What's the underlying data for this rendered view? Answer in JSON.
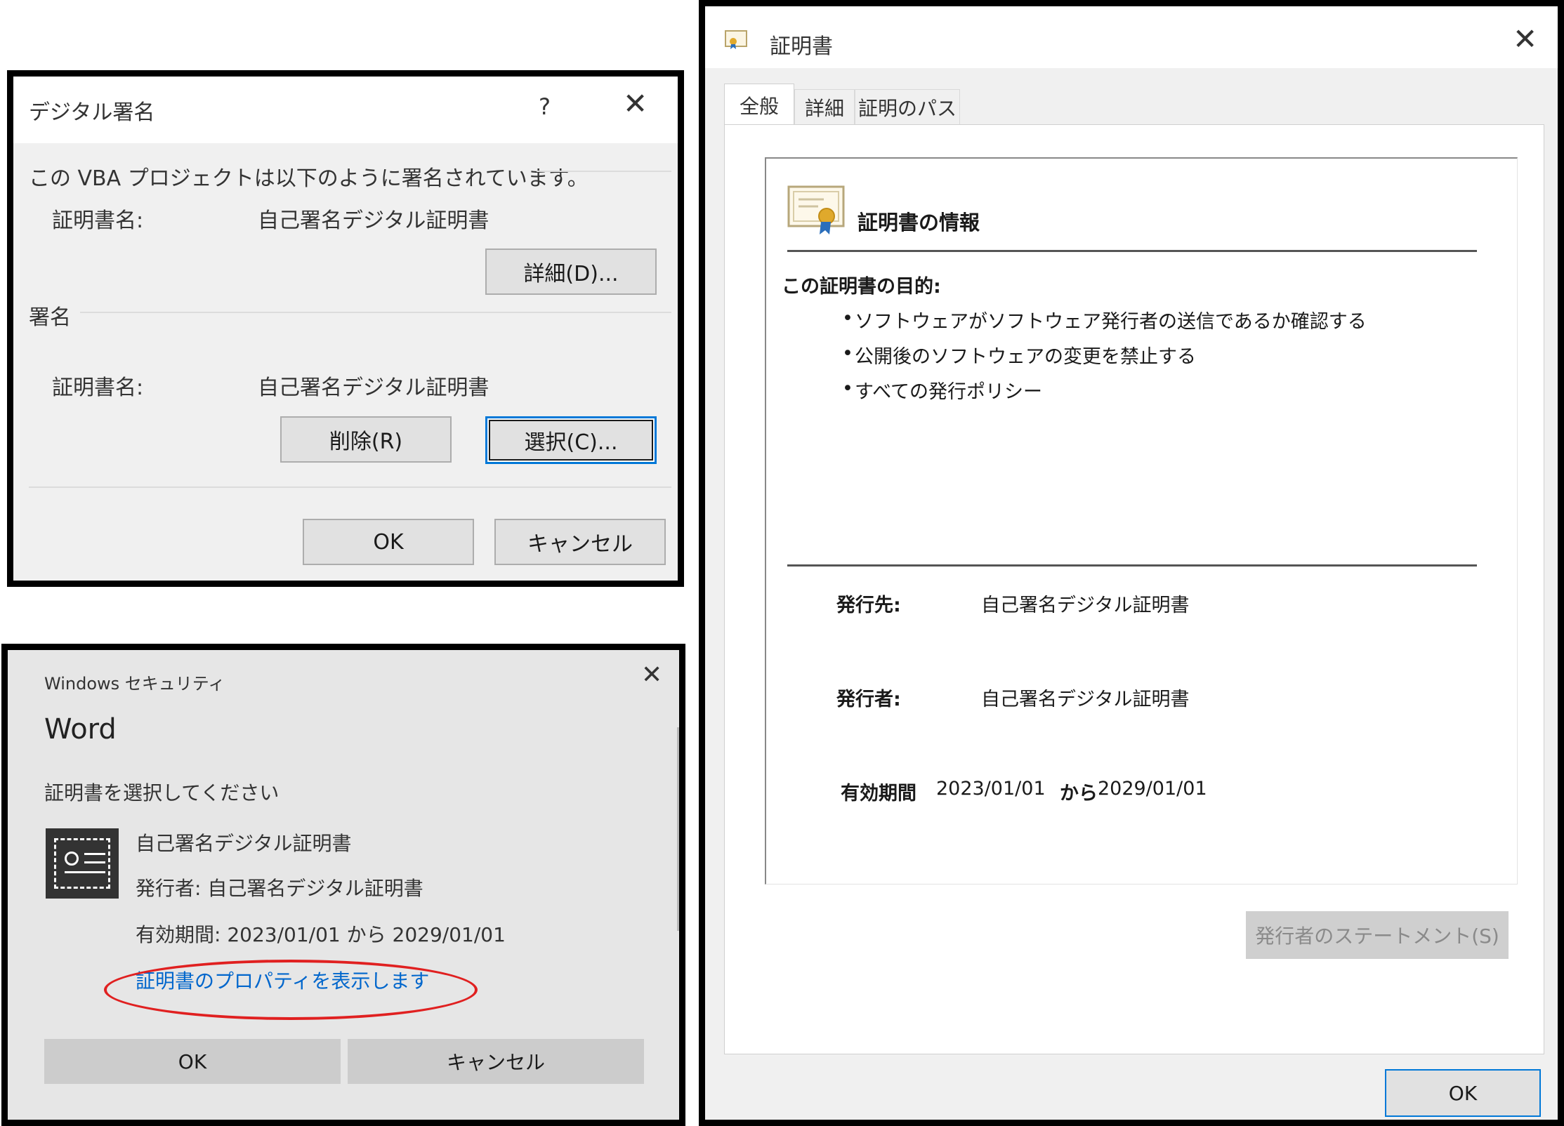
{
  "sig_dialog": {
    "title": "デジタル署名",
    "help": "?",
    "close": "✕",
    "intro": "この VBA プロジェクトは以下のように署名されています。",
    "cert_name_label": "証明書名:",
    "cert_name_value": "自己署名デジタル証明書",
    "details_button": "詳細(D)...",
    "sign_section": "署名",
    "sign_cert_label": "証明書名:",
    "sign_cert_value": "自己署名デジタル証明書",
    "delete_button": "削除(R)",
    "select_button": "選択(C)...",
    "ok_button": "OK",
    "cancel_button": "キャンセル"
  },
  "security_dialog": {
    "caption": "Windows セキュリティ",
    "close": "✕",
    "app_name": "Word",
    "prompt": "証明書を選択してください",
    "cert_name": "自己署名デジタル証明書",
    "issuer": "発行者: 自己署名デジタル証明書",
    "validity": "有効期間: 2023/01/01 から 2029/01/01",
    "properties_link": "証明書のプロパティを表示します",
    "ok_button": "OK",
    "cancel_button": "キャンセル",
    "highlight_color": "#e02020"
  },
  "cert_dialog": {
    "title": "証明書",
    "close": "✕",
    "tabs": [
      {
        "label": "全般",
        "active": true
      },
      {
        "label": "詳細",
        "active": false
      },
      {
        "label": "証明のパス",
        "active": false
      }
    ],
    "info_heading": "証明書の情報",
    "purpose_heading": "この証明書の目的:",
    "purposes": [
      "ソフトウェアがソフトウェア発行者の送信であるか確認する",
      "公開後のソフトウェアの変更を禁止する",
      "すべての発行ポリシー"
    ],
    "issued_to_label": "発行先:",
    "issued_to_value": "自己署名デジタル証明書",
    "issued_by_label": "発行者:",
    "issued_by_value": "自己署名デジタル証明書",
    "validity_label": "有効期間",
    "valid_from": "2023/01/01",
    "valid_sep": "から",
    "valid_to": "2029/01/01",
    "issuer_statement_button": "発行者のステートメント(S)",
    "ok_button": "OK"
  }
}
